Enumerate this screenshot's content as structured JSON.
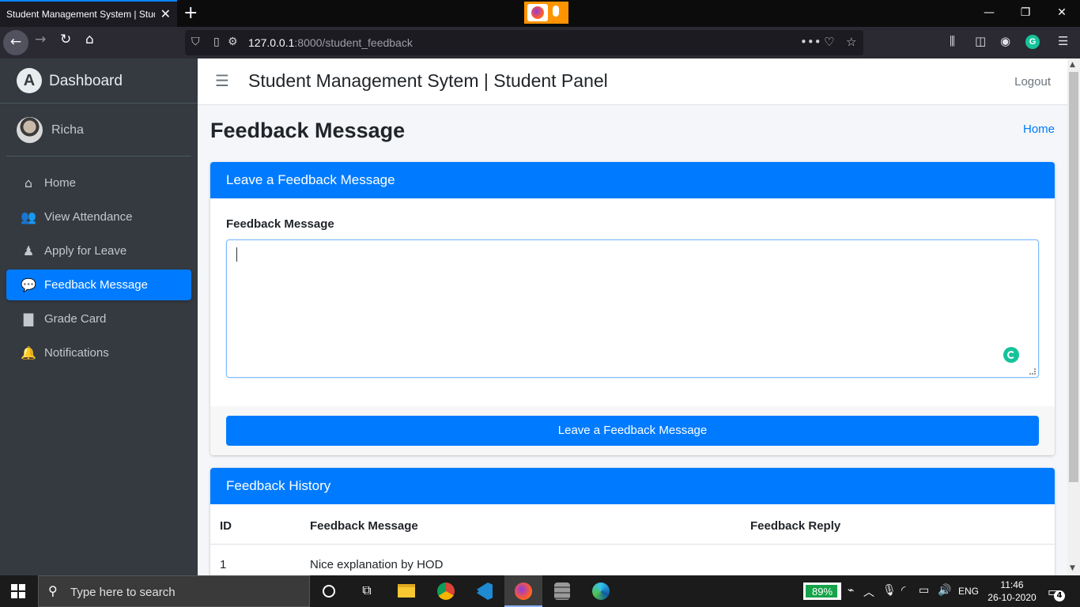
{
  "browser": {
    "tab_title": "Student Management System | Student Panel",
    "url_host": "127.0.0.1",
    "url_path": ":8000/student_feedback"
  },
  "sidebar": {
    "brand": "Dashboard",
    "user_name": "Richa",
    "items": [
      {
        "label": "Home",
        "icon": "home-icon",
        "glyph": "⌂"
      },
      {
        "label": "View Attendance",
        "icon": "users-icon",
        "glyph": "👥"
      },
      {
        "label": "Apply for Leave",
        "icon": "person-icon",
        "glyph": "♟"
      },
      {
        "label": "Feedback Message",
        "icon": "comments-icon",
        "glyph": "💬",
        "active": true
      },
      {
        "label": "Grade Card",
        "icon": "file-icon",
        "glyph": "▇"
      },
      {
        "label": "Notifications",
        "icon": "bell-icon",
        "glyph": "🔔"
      }
    ]
  },
  "header": {
    "title": "Student Management Sytem | Student Panel",
    "logout": "Logout"
  },
  "page": {
    "title": "Feedback Message",
    "breadcrumb_home": "Home"
  },
  "feedback_form": {
    "card_title": "Leave a Feedback Message",
    "field_label": "Feedback Message",
    "field_value": "",
    "submit_label": "Leave a Feedback Message"
  },
  "history": {
    "card_title": "Feedback History",
    "columns": [
      "ID",
      "Feedback Message",
      "Feedback Reply"
    ],
    "rows": [
      {
        "id": "1",
        "message": "Nice explanation by HOD",
        "reply": ""
      }
    ]
  },
  "taskbar": {
    "search_placeholder": "Type here to search",
    "battery": "89%",
    "language": "ENG",
    "time": "11:46",
    "date": "26-10-2020",
    "notifications": "4"
  },
  "colors": {
    "primary": "#007bff",
    "sidebar_bg": "#343a40",
    "grammarly": "#15c39a"
  }
}
